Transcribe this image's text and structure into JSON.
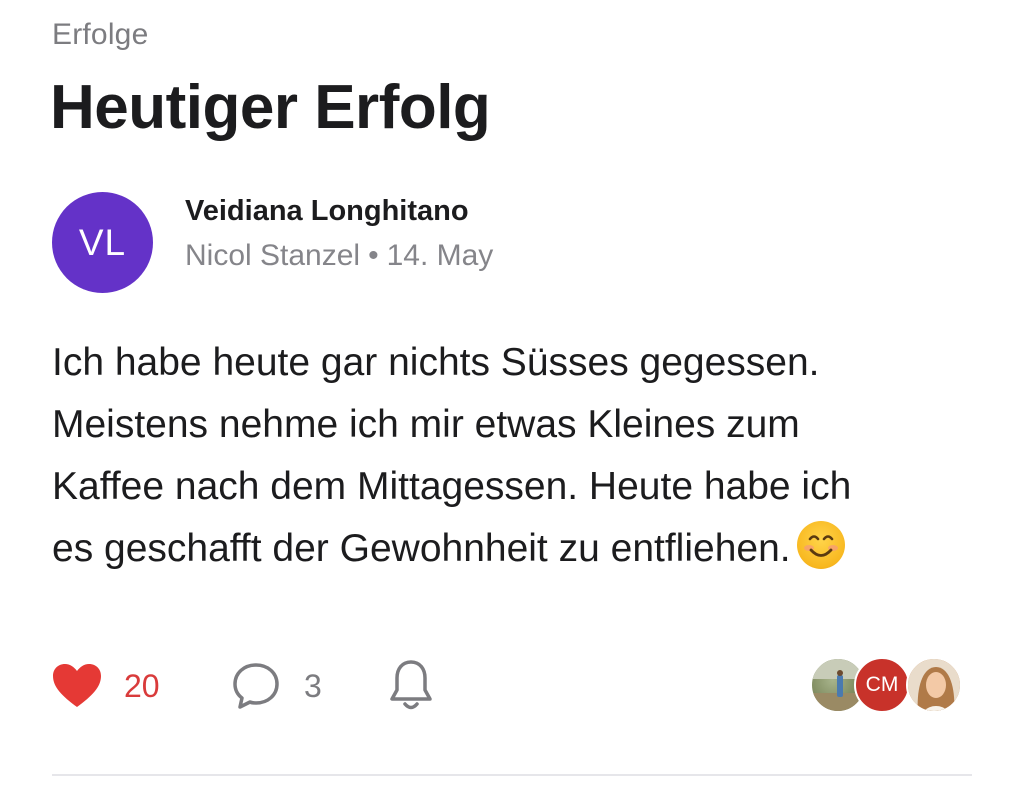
{
  "section": {
    "label": "Erfolge"
  },
  "post": {
    "title": "Heutiger Erfolg",
    "author": {
      "initials": "VL",
      "name": "Veidiana Longhitano",
      "coach": "Nicol Stanzel",
      "separator": "•",
      "date": "14. May",
      "avatar_color": "#6432C8"
    },
    "body": {
      "line1": "Ich habe heute gar nichts Süsses gegessen.",
      "line2": "Meistens nehme ich mir etwas Kleines zum",
      "line3": "Kaffee nach dem Mittagessen. Heute habe ich",
      "line4": "es geschafft der Gewohnheit zu entfliehen.",
      "emoji": "smiling-face-emoji"
    },
    "actions": {
      "likes": "20",
      "like_color": "#E53935",
      "comments": "3",
      "icons": [
        "heart-icon",
        "comment-bubble-icon",
        "bell-icon"
      ]
    },
    "participants": [
      {
        "kind": "photo",
        "name": "participant-photo-1"
      },
      {
        "kind": "initials",
        "initials": "CM",
        "color": "#C8322A"
      },
      {
        "kind": "photo",
        "name": "participant-photo-2"
      }
    ]
  }
}
